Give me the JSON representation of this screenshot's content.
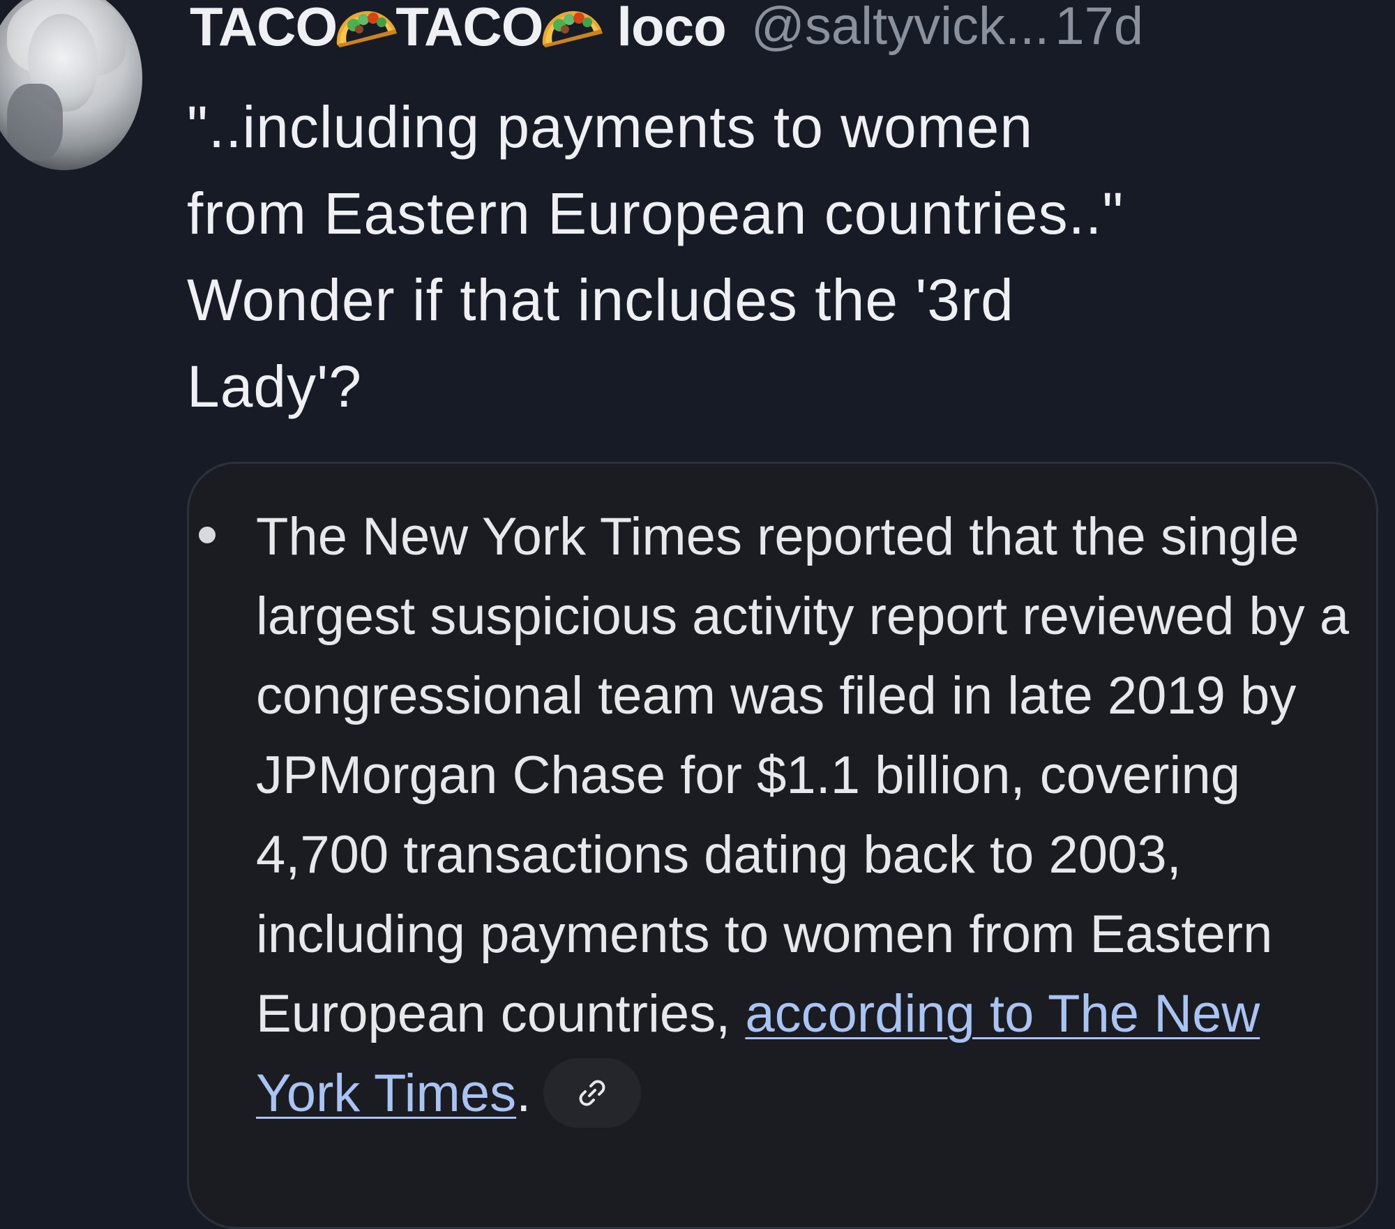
{
  "post": {
    "name_part1": "TACO",
    "name_part2": "TACO",
    "name_part3": "loco",
    "handle": "@saltyvick...",
    "time": "17d",
    "icons": [
      "avatar",
      "taco-emoji",
      "taco-emoji"
    ],
    "text_lines": [
      "\"..including payments to women",
      "from Eastern European countries..\"",
      "Wonder if that includes the '3rd",
      "Lady'?"
    ]
  },
  "quote": {
    "text_before_link": "The New York Times reported that the single largest suspicious activity report reviewed by a congressional team was filed in late 2019 by JPMorgan Chase for $1.1 billion, covering 4,700 transactions dating back to 2003, including payments to women from Eastern European countries, ",
    "link_text": "according to The New York Times",
    "text_after_link": ".",
    "link_icon": "link-icon"
  },
  "colors": {
    "background": "#161b26",
    "card_background": "#1b1c21",
    "link": "#a9c4f2",
    "muted": "#8a919c"
  }
}
